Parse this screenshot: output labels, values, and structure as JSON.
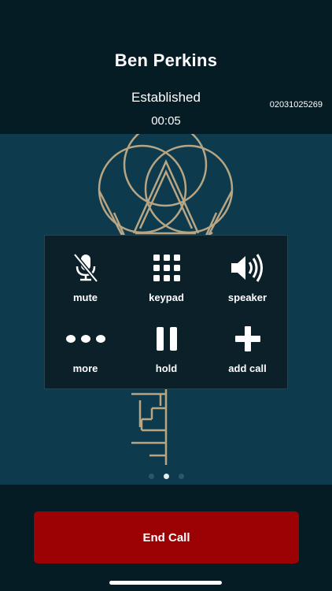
{
  "call": {
    "caller_name": "Ben Perkins",
    "status": "Established",
    "timer": "00:05",
    "number": "02031025269"
  },
  "controls": [
    {
      "label": "mute",
      "icon": "microphone-muted-icon"
    },
    {
      "label": "keypad",
      "icon": "keypad-icon"
    },
    {
      "label": "speaker",
      "icon": "speaker-icon"
    },
    {
      "label": "more",
      "icon": "more-dots-icon"
    },
    {
      "label": "hold",
      "icon": "pause-icon"
    },
    {
      "label": "add call",
      "icon": "plus-icon"
    }
  ],
  "pager": {
    "pages": 3,
    "active": 2
  },
  "end_call": {
    "label": "End Call"
  },
  "colors": {
    "background": "#061c25",
    "stage": "#0d3a4d",
    "logo": "#b8a583",
    "end_call": "#9c0204"
  }
}
